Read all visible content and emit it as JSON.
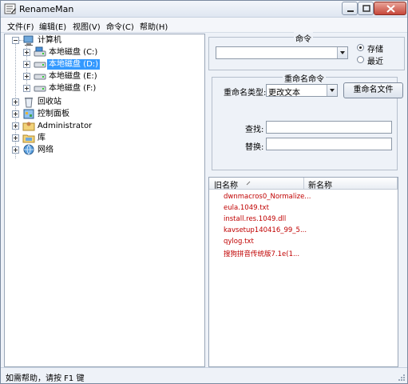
{
  "window": {
    "title": "RenameMan"
  },
  "menu": [
    "文件(F)",
    "编辑(E)",
    "视图(V)",
    "命令(C)",
    "帮助(H)"
  ],
  "tree": {
    "root": "计算机",
    "drives": [
      {
        "label": "本地磁盘 (C:)",
        "selected": false
      },
      {
        "label": "本地磁盘 (D:)",
        "selected": true
      },
      {
        "label": "本地磁盘 (E:)",
        "selected": false
      },
      {
        "label": "本地磁盘 (F:)",
        "selected": false
      }
    ],
    "others": [
      "回收站",
      "控制面板",
      "Administrator",
      "库",
      "网络"
    ]
  },
  "command_group": {
    "title": "命令",
    "dropdown_value": "",
    "radio_store": "存储",
    "radio_recent": "最近",
    "selected": "store"
  },
  "rename_group": {
    "title": "重命名命令",
    "type_label": "重命名类型:",
    "type_value": "更改文本",
    "rename_button": "重命名文件",
    "find_label": "查找:",
    "replace_label": "替换:",
    "find_value": "",
    "replace_value": ""
  },
  "file_list": {
    "col_old": "旧名称",
    "col_new": "新名称",
    "rows": [
      {
        "old": "dwnmacros0_Normalize...",
        "new": ""
      },
      {
        "old": "eula.1049.txt",
        "new": ""
      },
      {
        "old": "install.res.1049.dll",
        "new": ""
      },
      {
        "old": "kavsetup140416_99_5...",
        "new": ""
      },
      {
        "old": "qylog.txt",
        "new": ""
      },
      {
        "old": "搜狗拼音传统版7.1e(1...",
        "new": ""
      }
    ],
    "row_color": "#c00000"
  },
  "status": {
    "text": "如需帮助，请按 F1 键"
  }
}
